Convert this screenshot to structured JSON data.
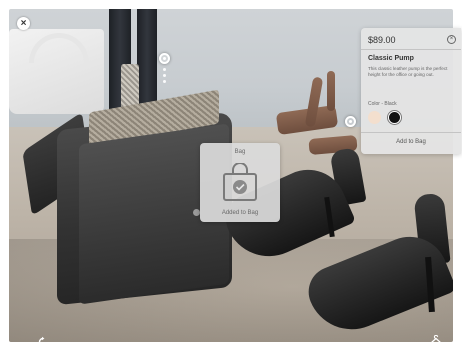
{
  "screen": {
    "background": "#c7c1b6"
  },
  "overlay": {
    "close_icon": "close-icon",
    "close_glyph": "×",
    "hotspots": [
      "hotspot-bag",
      "hotspot-shoe"
    ]
  },
  "added_card": {
    "title": "Bag",
    "message": "Added to Bag",
    "icon": "shopping-bag-check-icon"
  },
  "product_panel": {
    "price": "$89.00",
    "close_glyph": "×",
    "name": "Classic Pump",
    "description": "This classic leather pump is the perfect height for the office or going out.",
    "color_label": "Color - Black",
    "swatches": [
      {
        "name": "Nude",
        "color": "#f3dfce",
        "selected": false
      },
      {
        "name": "Black",
        "color": "#111111",
        "selected": true
      }
    ],
    "add_button": "Add to Bag"
  },
  "bottom_bar": {
    "left_icon": "reset-icon",
    "right_icon": "hanger-icon"
  }
}
